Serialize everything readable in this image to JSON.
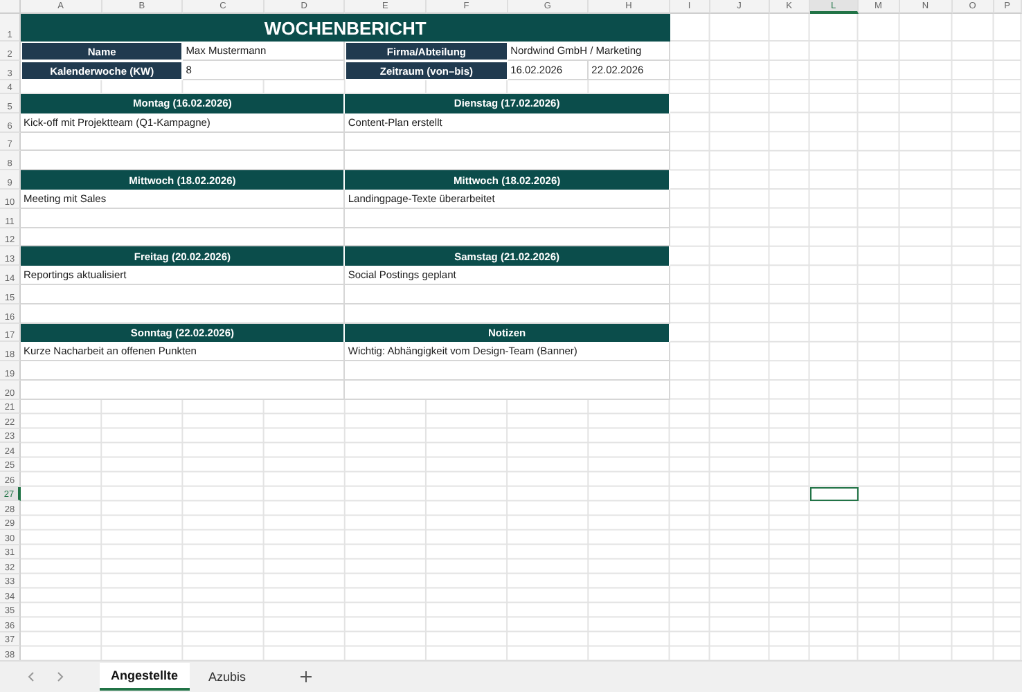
{
  "sheet": {
    "columns": [
      {
        "label": "A",
        "selected": false
      },
      {
        "label": "B",
        "selected": false
      },
      {
        "label": "C",
        "selected": false
      },
      {
        "label": "D",
        "selected": false
      },
      {
        "label": "E",
        "selected": false
      },
      {
        "label": "F",
        "selected": false
      },
      {
        "label": "G",
        "selected": false
      },
      {
        "label": "H",
        "selected": false
      },
      {
        "label": "I",
        "selected": false
      },
      {
        "label": "J",
        "selected": false
      },
      {
        "label": "K",
        "selected": false
      },
      {
        "label": "L",
        "selected": true
      },
      {
        "label": "M",
        "selected": false
      },
      {
        "label": "N",
        "selected": false
      },
      {
        "label": "O",
        "selected": false
      },
      {
        "label": "P",
        "selected": false
      }
    ],
    "rows": [
      {
        "label": "1",
        "selected": false
      },
      {
        "label": "2",
        "selected": false
      },
      {
        "label": "3",
        "selected": false
      },
      {
        "label": "4",
        "selected": false
      },
      {
        "label": "5",
        "selected": false
      },
      {
        "label": "6",
        "selected": false
      },
      {
        "label": "7",
        "selected": false
      },
      {
        "label": "8",
        "selected": false
      },
      {
        "label": "9",
        "selected": false
      },
      {
        "label": "10",
        "selected": false
      },
      {
        "label": "11",
        "selected": false
      },
      {
        "label": "12",
        "selected": false
      },
      {
        "label": "13",
        "selected": false
      },
      {
        "label": "14",
        "selected": false
      },
      {
        "label": "15",
        "selected": false
      },
      {
        "label": "16",
        "selected": false
      },
      {
        "label": "17",
        "selected": false
      },
      {
        "label": "18",
        "selected": false
      },
      {
        "label": "19",
        "selected": false
      },
      {
        "label": "20",
        "selected": false
      },
      {
        "label": "21",
        "selected": false
      },
      {
        "label": "22",
        "selected": false
      },
      {
        "label": "23",
        "selected": false
      },
      {
        "label": "24",
        "selected": false
      },
      {
        "label": "25",
        "selected": false
      },
      {
        "label": "26",
        "selected": false
      },
      {
        "label": "27",
        "selected": true
      },
      {
        "label": "28",
        "selected": false
      },
      {
        "label": "29",
        "selected": false
      },
      {
        "label": "30",
        "selected": false
      },
      {
        "label": "31",
        "selected": false
      },
      {
        "label": "32",
        "selected": false
      },
      {
        "label": "33",
        "selected": false
      },
      {
        "label": "34",
        "selected": false
      },
      {
        "label": "35",
        "selected": false
      },
      {
        "label": "36",
        "selected": false
      },
      {
        "label": "37",
        "selected": false
      },
      {
        "label": "38",
        "selected": false
      }
    ]
  },
  "report": {
    "title": "WOCHENBERICHT",
    "info": [
      {
        "label": "Name",
        "values": [
          "Max Mustermann"
        ]
      },
      {
        "label": "Firma/Abteilung",
        "values": [
          "Nordwind GmbH / Marketing"
        ]
      },
      {
        "label": "Kalenderwoche (KW)",
        "values": [
          "8"
        ]
      },
      {
        "label": "Zeitraum (von–bis)",
        "values": [
          "16.02.2026",
          "22.02.2026"
        ]
      }
    ],
    "days": [
      {
        "header": "Montag (16.02.2026)",
        "entries": [
          "Kick-off mit Projektteam (Q1-Kampagne)"
        ]
      },
      {
        "header": "Dienstag (17.02.2026)",
        "entries": [
          "Content-Plan erstellt"
        ]
      },
      {
        "header": "Mittwoch (18.02.2026)",
        "entries": [
          "Meeting mit Sales"
        ]
      },
      {
        "header": "Mittwoch (18.02.2026)",
        "entries": [
          "Landingpage-Texte überarbeitet"
        ]
      },
      {
        "header": "Freitag (20.02.2026)",
        "entries": [
          "Reportings aktualisiert"
        ]
      },
      {
        "header": "Samstag (21.02.2026)",
        "entries": [
          "Social Postings geplant"
        ]
      },
      {
        "header": "Sonntag (22.02.2026)",
        "entries": [
          "Kurze Nacharbeit an offenen Punkten"
        ]
      },
      {
        "header": "Notizen",
        "entries": [
          "Wichtig: Abhängigkeit vom Design-Team (Banner)"
        ]
      }
    ]
  },
  "sheet_tabs": [
    {
      "label": "Angestellte",
      "selected": true
    },
    {
      "label": "Azubis",
      "selected": false
    }
  ]
}
